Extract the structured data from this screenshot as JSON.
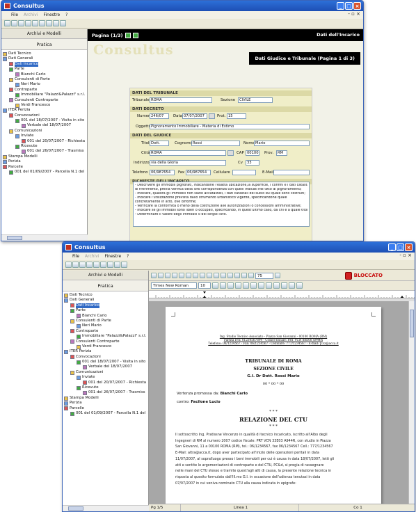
{
  "app": {
    "title": "Consultus"
  },
  "menu": {
    "file": "File",
    "archive": "Archivi",
    "windows": "Finestre",
    "help": "?"
  },
  "sidebar": {
    "header": "Archivi e Modelli",
    "section": "Pratica",
    "tree": [
      {
        "label": "Dati Tecnico",
        "level": 0,
        "selected": false
      },
      {
        "label": "Dati Generali",
        "level": 0,
        "selected": false
      },
      {
        "label": "Dati Incarico",
        "level": 1,
        "selected": true
      },
      {
        "label": "Parte",
        "level": 1,
        "selected": false
      },
      {
        "label": "Bianchi Carlo",
        "level": 2,
        "selected": false
      },
      {
        "label": "Consulenti di Parte",
        "level": 1,
        "selected": false
      },
      {
        "label": "Neri Mario",
        "level": 2,
        "selected": false
      },
      {
        "label": "Controparte",
        "level": 1,
        "selected": false
      },
      {
        "label": "Immobiliare \"Palazzi&Palazzi\" s.r.l.",
        "level": 2,
        "selected": false
      },
      {
        "label": "Consulenti Controparte",
        "level": 1,
        "selected": false
      },
      {
        "label": "Verdi Francesco",
        "level": 2,
        "selected": false
      },
      {
        "label": "ITER Perizia",
        "level": 0,
        "selected": false
      },
      {
        "label": "Convocazioni",
        "level": 1,
        "selected": false
      },
      {
        "label": "001 del 18/07/2007 - Visita in sito",
        "level": 2,
        "selected": false
      },
      {
        "label": "Verbale del 18/07/2007",
        "level": 3,
        "selected": false
      },
      {
        "label": "Comunicazioni",
        "level": 1,
        "selected": false
      },
      {
        "label": "Inviate",
        "level": 2,
        "selected": false
      },
      {
        "label": "001 del 20/07/2007 - Richiesta",
        "level": 3,
        "selected": false
      },
      {
        "label": "Ricevute",
        "level": 2,
        "selected": false
      },
      {
        "label": "001 del 26/07/2007 - Trasmiss",
        "level": 3,
        "selected": false
      },
      {
        "label": "Stampa Modelli",
        "level": 0,
        "selected": false
      },
      {
        "label": "Perizia",
        "level": 0,
        "selected": false
      },
      {
        "label": "Parcelle",
        "level": 0,
        "selected": false
      },
      {
        "label": "001 del 01/09/2007 - Parcella N.1 del",
        "level": 1,
        "selected": false
      }
    ]
  },
  "window1": {
    "page_indicator": "Pagina (1/3)",
    "header_right": "Dati dell'Incarico",
    "brand": "Consultus",
    "page_title": "Dati Giudice e Tribunale (Pagina 1 di 3)",
    "form": {
      "sec_tribunale": "DATI DEL TRIBUNALE",
      "tribunale_label": "Tribunale di",
      "tribunale_value": "ROMA",
      "sezione_label": "Sezione",
      "sezione_value": "CIVILE",
      "sec_decreto": "DATI DECRETO",
      "numero_label": "Numero",
      "numero_value": "246/07",
      "data_label": "Data",
      "data_value": "07/07/2007",
      "prot_label": "Prot.",
      "prot_value": "15",
      "oggetto_label": "Oggetto",
      "oggetto_value": "Pignoramento Immobiliare - Materia di Estimo",
      "sec_giudice": "DATI DEL GIUDICE",
      "titolo_label": "Titolo",
      "titolo_value": "Dott.",
      "cognome_label": "Cognome",
      "cognome_value": "Rossi",
      "nome_label": "Nome",
      "nome_value": "Mario",
      "citta_label": "Città",
      "citta_value": "ROMA",
      "cap_label": "CAP",
      "cap_value": "00100",
      "prov_label": "Prov.",
      "prov_value": "RM",
      "indirizzo_label": "Indirizzo",
      "indirizzo_value": "via della Gloria",
      "civ_label": "Cv",
      "civ_value": "33",
      "telefono_label": "Telefono",
      "telefono_value": "06/987654",
      "fax_label": "Fax",
      "fax_value": "06/987654",
      "cellulare_label": "Cellulare",
      "cellulare_value": "",
      "email_label": "E-Mail",
      "email_value": "",
      "sec_richieste": "RICHIESTE DELL'INCARICO",
      "richieste_lines": [
        "- Descrivere gli immobili pignorati, indicandone l'esatta ubicazione,la superficie, i confini e i dati catastali",
        "di riferimento, previa verifica della loro corrispondenza con quelli indicati nell'atto di pignoramento;",
        "- Indicare, qualora gli immobili non siano accatastati, i dati catastali del suolo sul quale sono costruiti;",
        "- Indicare l'utilizzazione prevista dallo strumento urbanistico vigente, specificandone quale",
        "concretamente in atto, ove difforme;",
        "- Verificare la conformità o meno della costruzione alle autorizzazioni o concessioni amministrative;",
        "- Indicare se gli immobili sono liberi o occupati, specificando, in quest'ultimo caso, da chi e a quale titolo;",
        "- Determinare il valore degli immobili o dei singoli lotti."
      ]
    }
  },
  "window2": {
    "bloccato": "BLOCCATO",
    "font_name": "Times New Roman",
    "font_size": "10",
    "zoom": "75",
    "doc": {
      "letterhead": [
        "Ing. Studio Tecnico Associato - Piazza San Giovanni - 00100 ROMA (RM)",
        "Partita IVA: 01234567899 - Codice fiscale: PRT VCN 88E00 A944R",
        "Telefono: 06/1234567 - Fax: 06/1234567 - Cellulare: 777/1234567 - E-mail: p.vz@acca.it"
      ],
      "court": "TRIBUNALE DI ROMA",
      "section": "SEZIONE CIVILE",
      "judge": "G.I. Dr Dott. Rossi Mario",
      "number": "00 * 00 * 00",
      "vertenza_label": "Vertenza promossa da:",
      "vertenza_value": "Bianchi Carlo",
      "contro_label": "contro:",
      "contro_value": "Facilone Lucio",
      "stars": "* * *",
      "heading": "RELAZIONE DEL CTU",
      "body_lines": [
        "Il sottoscritto Ing. Pratissne Vincenzo in qualità di tecnico incaricato, iscritto all'Albo degli",
        "Ingegneri di RM al numero 2007 codice fiscale: PRT VCN 33E03 A944R, con studio in Piazza",
        "San Giovanni, 11 a 00100 ROMA (RM), tel.: 06/1234567, fax 06/1234567 Cell.: 777/1234567",
        "E-Mail: altra@acca.it, dopo aver partecipato all'inizio delle operazioni peritali in data",
        "11/07/2007, al sopralluogo presso i beni immobili per cui è causa in data 18/07/2007, letti gli",
        "atti e sentite le argomentazioni di controparte e del CTU, PC&d, si pregia di rassegnare",
        "nelle mani del CTU stesso e tramite quest'agli atti di causa, la presente relazione tecnica in",
        "risposta al quesito formulato dall'Ill.mo G.I. in occasione dell'udienza tenutasi in data",
        "07/07/2007 in cui veniva nominato CTU alla causa indicata in epigrafe:"
      ]
    },
    "status": {
      "page": "Pg 1/5",
      "line": "Linea 1",
      "col": "Co 1"
    }
  }
}
